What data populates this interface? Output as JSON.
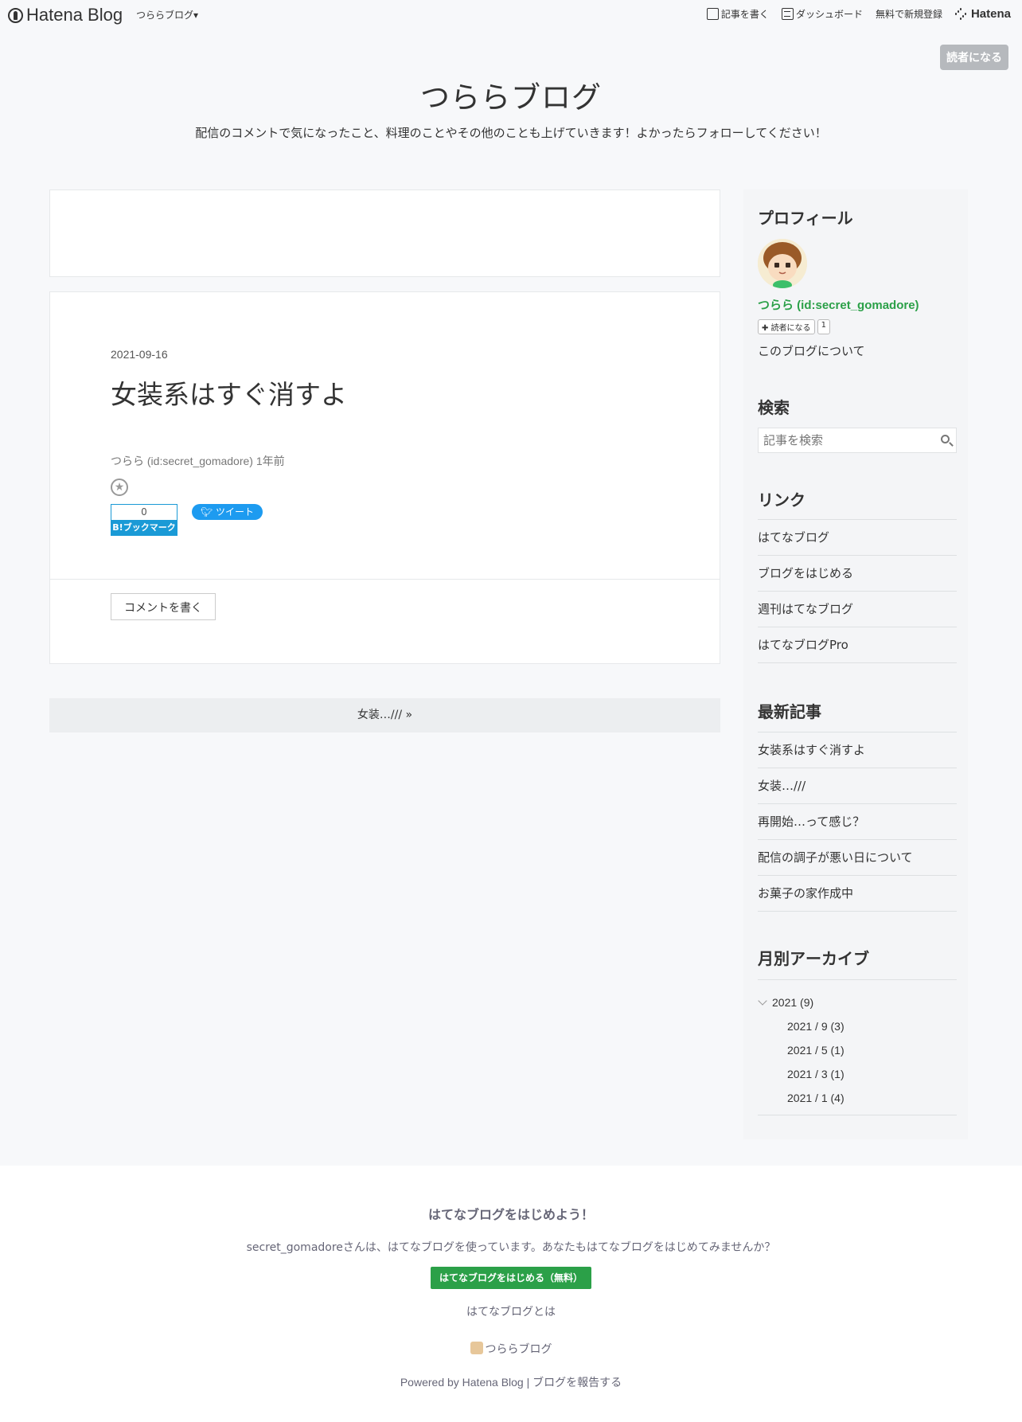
{
  "global_header": {
    "logo_text": "Hatena Blog",
    "blog_selector": "つららブログ▾",
    "write": "記事を書く",
    "dashboard": "ダッシュボード",
    "signup": "無料で新規登録",
    "hatena": "Hatena"
  },
  "subscribe_button": "読者になる",
  "blog": {
    "title": "つららブログ",
    "description": "配信のコメントで気になったこと、料理のことやその他のことも上げていきます！よかったらフォローしてください！"
  },
  "entry": {
    "date": "2021-09-16",
    "title": "女装系はすぐ消すよ",
    "author_line": "つらら (id:secret_gomadore) 1年前",
    "bookmark_count": "0",
    "bookmark_label": "B!ブックマーク",
    "tweet_label": "ツイート",
    "comment_button": "コメントを書く"
  },
  "pager": {
    "next": "女装…/// »"
  },
  "sidebar": {
    "profile": {
      "heading": "プロフィール",
      "name": "つらら (id:secret_gomadore)",
      "subscribe": "読者になる",
      "subscriber_count": "1",
      "about": "このブログについて"
    },
    "search": {
      "heading": "検索",
      "placeholder": "記事を検索"
    },
    "links": {
      "heading": "リンク",
      "items": [
        "はてなブログ",
        "ブログをはじめる",
        "週刊はてなブログ",
        "はてなブログPro"
      ]
    },
    "recent": {
      "heading": "最新記事",
      "items": [
        "女装系はすぐ消すよ",
        "女装…///",
        "再開始…って感じ？",
        "配信の調子が悪い日について",
        "お菓子の家作成中"
      ]
    },
    "archive": {
      "heading": "月別アーカイブ",
      "year": "2021 (9)",
      "months": [
        "2021 / 9 (3)",
        "2021 / 5 (1)",
        "2021 / 3 (1)",
        "2021 / 1 (4)"
      ]
    }
  },
  "footer": {
    "cta_title": "はてなブログをはじめよう！",
    "cta_text": "secret_gomadoreさんは、はてなブログを使っています。あなたもはてなブログをはじめてみませんか？",
    "cta_button": "はてなブログをはじめる（無料）",
    "about_link": "はてなブログとは",
    "blog_name": "つららブログ",
    "powered": "Powered by Hatena Blog",
    "report": "ブログを報告する"
  }
}
